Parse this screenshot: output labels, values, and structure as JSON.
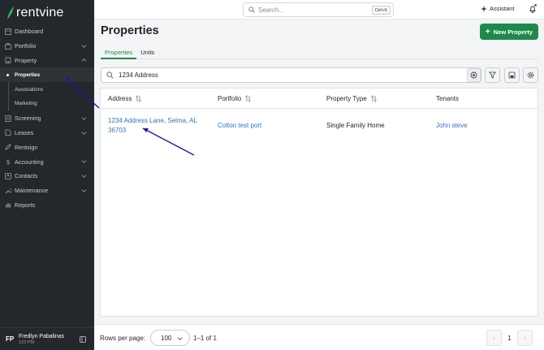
{
  "app": {
    "logo_text": "rentvine"
  },
  "sidebar": {
    "items": [
      {
        "label": "Dashboard",
        "icon": "dashboard-icon"
      },
      {
        "label": "Portfolio",
        "icon": "briefcase-icon",
        "chevron": true
      },
      {
        "label": "Property",
        "icon": "building-icon",
        "chevron": true,
        "expanded": true
      },
      {
        "label": "Screening",
        "icon": "screening-icon",
        "chevron": true
      },
      {
        "label": "Leases",
        "icon": "leases-icon",
        "chevron": true
      },
      {
        "label": "Rentsign",
        "icon": "pen-icon"
      },
      {
        "label": "Accounting",
        "icon": "dollar-icon",
        "chevron": true
      },
      {
        "label": "Contacts",
        "icon": "contacts-icon",
        "chevron": true
      },
      {
        "label": "Maintenance",
        "icon": "wrench-icon",
        "chevron": true
      },
      {
        "label": "Reports",
        "icon": "chart-icon"
      }
    ],
    "property_sub": [
      {
        "label": "Properties",
        "active": true
      },
      {
        "label": "Associations"
      },
      {
        "label": "Marketing"
      }
    ],
    "user": {
      "initials": "FP",
      "name": "Fredlyn Pabalinas",
      "sub": "123 PM"
    }
  },
  "topbar": {
    "search_placeholder": "Search...",
    "search_shortcut": "Ctrl+K",
    "assistant_label": "Assistant"
  },
  "main": {
    "title": "Properties",
    "new_button_label": "New Property",
    "tabs": [
      {
        "label": "Properties",
        "active": true
      },
      {
        "label": "Units"
      }
    ],
    "filter_value": "1234 Address",
    "table": {
      "columns": [
        "Address",
        "Portfolio",
        "Property Type",
        "Tenants"
      ],
      "rows": [
        {
          "address_line1": "1234 Address Lane, Selma, AL",
          "address_line2": "36703",
          "portfolio": "Colton test port",
          "property_type": "Single Family Home",
          "tenants": "John steve"
        }
      ]
    },
    "pagination": {
      "rows_per_page_label": "Rows per page:",
      "rows_per_page_value": "100",
      "range": "1–1 of 1",
      "current_page": "1"
    }
  },
  "colors": {
    "sidebar_bg": "#24272b",
    "accent_green": "#1e8a4a",
    "link_blue": "#2f74c0",
    "annotation_arrow": "#1a1aa8"
  }
}
